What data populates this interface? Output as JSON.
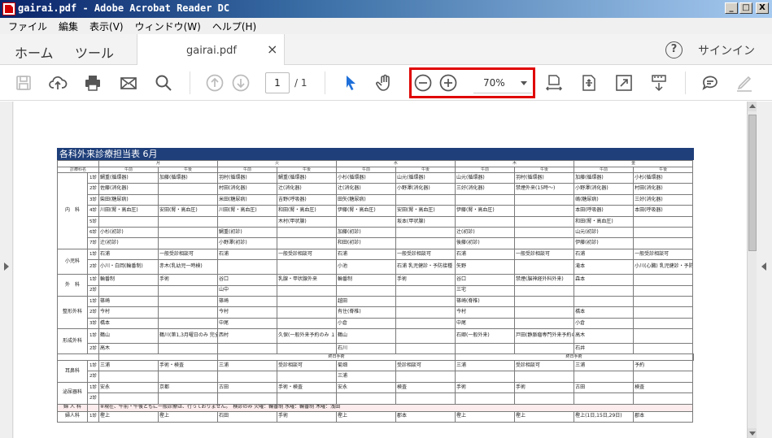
{
  "window": {
    "title": "gairai.pdf - Adobe Acrobat Reader DC",
    "min_label": "_",
    "max_label": "□",
    "close_label": "X"
  },
  "menu": [
    "ファイル",
    "編集",
    "表示(V)",
    "ウィンドウ(W)",
    "ヘルプ(H)"
  ],
  "tabs": {
    "home": "ホーム",
    "tools": "ツール",
    "doc_name": "gairai.pdf",
    "close": "×",
    "help": "?",
    "signin": "サインイン"
  },
  "toolbar": {
    "page_current": "1",
    "page_total": "/  1",
    "zoom": "70%",
    "highlight_color": "#e00000"
  },
  "document": {
    "title": "各科外来診療担当表 6月",
    "days": [
      "月",
      "火",
      "水",
      "木",
      "金"
    ],
    "am": "午前",
    "pm": "午後",
    "dept_header": "診療科名",
    "rows": [
      {
        "dept": "内　科",
        "num": "1診",
        "c": [
          "鯛重(循環器)",
          "加藤(循環器)",
          "羽村(循環器)",
          "鯛重(循環器)",
          "小杉(循環器)",
          "山元(循環器)",
          "山元(循環器)",
          "羽村(循環器)",
          "加藤(循環器)",
          "小杉(循環器)"
        ]
      },
      {
        "dept": "",
        "num": "2診",
        "c": [
          "佐藤(消化器)",
          "",
          "村田(消化器)",
          "辻(消化器)",
          "辻(消化器)",
          "小野澤(消化器)",
          "三好(消化器)",
          "禁煙外来(15時〜)",
          "小野澤(消化器)",
          "村田(消化器)"
        ]
      },
      {
        "dept": "",
        "num": "3診",
        "c": [
          "柴田(糖尿病)",
          "",
          "米田(糖尿病)",
          "吉野(呼吸器)",
          "田矢(糖尿病)",
          "",
          "",
          "",
          "嶋(糖尿病)",
          "三好(消化器)"
        ]
      },
      {
        "dept": "",
        "num": "4診",
        "c": [
          "川田(腎・高血圧)",
          "安田(腎・高血圧)",
          "川田(腎・高血圧)",
          "和田(腎・高血圧)",
          "伊藤(腎・高血圧)",
          "安田(腎・高血圧)",
          "伊藤(腎・高血圧)",
          "",
          "本田(呼吸器)",
          "本田(呼吸器)"
        ]
      },
      {
        "dept": "",
        "num": "5診",
        "c": [
          "",
          "",
          "",
          "木村(甲状腺)",
          "",
          "坂本(甲状腺)",
          "",
          "",
          "和田(腎・高血圧)",
          ""
        ]
      },
      {
        "dept": "",
        "num": "6診",
        "c": [
          "小杉(初診)",
          "",
          "鯛重(初診)",
          "",
          "加藤(初診)",
          "",
          "辻(初診)",
          "",
          "山元(初診)",
          ""
        ]
      },
      {
        "dept": "",
        "num": "7診",
        "c": [
          "辻(初診)",
          "",
          "小野澤(初診)",
          "",
          "和田(初診)",
          "",
          "後藤(初診)",
          "",
          "伊藤(初診)",
          ""
        ]
      },
      {
        "dept": "小児科",
        "num": "1診",
        "c": [
          "石浦",
          "一般受診相談可",
          "石浦",
          "一般受診相談可",
          "石浦",
          "一般受診相談可",
          "石浦",
          "一般受診相談可",
          "石浦",
          "一般受診相談可"
        ]
      },
      {
        "dept": "",
        "num": "2診",
        "c": [
          "小川・白岡(輪番制)",
          "赤木(乳幼児一時検)",
          "",
          "",
          "小池",
          "石浦 乳児健診・予防接種",
          "矢野",
          "",
          "滝本",
          "小川(心臓) 乳児健診・予防接種"
        ]
      },
      {
        "dept": "外　科",
        "num": "1診",
        "c": [
          "輪番制",
          "手術",
          "谷口",
          "乳腺・甲状腺外来",
          "輪番制",
          "手術",
          "谷口",
          "禁煙(脳神経外科外来)",
          "森本",
          ""
        ]
      },
      {
        "dept": "",
        "num": "2診",
        "c": [
          "",
          "",
          "山中",
          "",
          "",
          "",
          "三宅",
          "",
          "",
          ""
        ]
      },
      {
        "dept": "整形外科",
        "num": "1診",
        "c": [
          "篠崎",
          "",
          "篠崎",
          "",
          "越田",
          "",
          "篠崎(脊椎)",
          "",
          "",
          ""
        ]
      },
      {
        "dept": "",
        "num": "2診",
        "c": [
          "今村",
          "",
          "今村",
          "",
          "有住(脊椎)",
          "",
          "今村",
          "",
          "橋本",
          ""
        ]
      },
      {
        "dept": "",
        "num": "3診",
        "c": [
          "橋本",
          "",
          "中尾",
          "",
          "小倉",
          "",
          "中尾",
          "",
          "小倉",
          ""
        ]
      },
      {
        "dept": "形成外科",
        "num": "1診",
        "c": [
          "鶴山",
          "鶴川(第1,3月曜日のみ 完全予約制)",
          "西村",
          "久保(一般外来予約のみ １４時〜１６時)",
          "鶴山",
          "",
          "石卿(一般外来)",
          "戸田(静脈瘤専門外来予約のみ 14日,28日14時〜15時30分)",
          "高木",
          ""
        ]
      },
      {
        "dept": "",
        "num": "2診",
        "c": [
          "高木",
          "",
          "",
          "",
          "石川",
          "",
          "",
          "",
          "石井",
          ""
        ]
      },
      {
        "dept": "耳鼻科",
        "num": "1診",
        "c": [
          "三浦",
          "手術・検査",
          "三浦",
          "受診相談可",
          "菊畑",
          "受診相談可",
          "三浦",
          "受診相談可",
          "三浦",
          "予約"
        ]
      },
      {
        "dept": "",
        "num": "2診",
        "c": [
          "",
          "",
          "",
          "",
          "三浦",
          "",
          "",
          "",
          "",
          ""
        ]
      },
      {
        "dept": "泌尿器科",
        "num": "1診",
        "c": [
          "安永",
          "京都",
          "古田",
          "手術・検査",
          "安永",
          "検査",
          "手術",
          "手術",
          "古田",
          "検査"
        ]
      },
      {
        "dept": "",
        "num": "2診",
        "c": [
          "",
          "",
          "",
          "",
          "",
          "",
          "",
          "",
          "",
          ""
        ]
      },
      {
        "dept": "婦人科",
        "num": "1診",
        "c": [
          "樫上",
          "樫上",
          "石田",
          "手術",
          "樫上",
          "郡本",
          "樫上",
          "樫上",
          "樫上(1日,15日,29日)",
          "郡本"
        ]
      }
    ],
    "sub_label": "終日手術",
    "band_note": "※現在、午前・午後ともに一般診療は、行っておりません。　検診のみ 火曜：輪番制 水曜：輪番制 木曜：浅田"
  }
}
